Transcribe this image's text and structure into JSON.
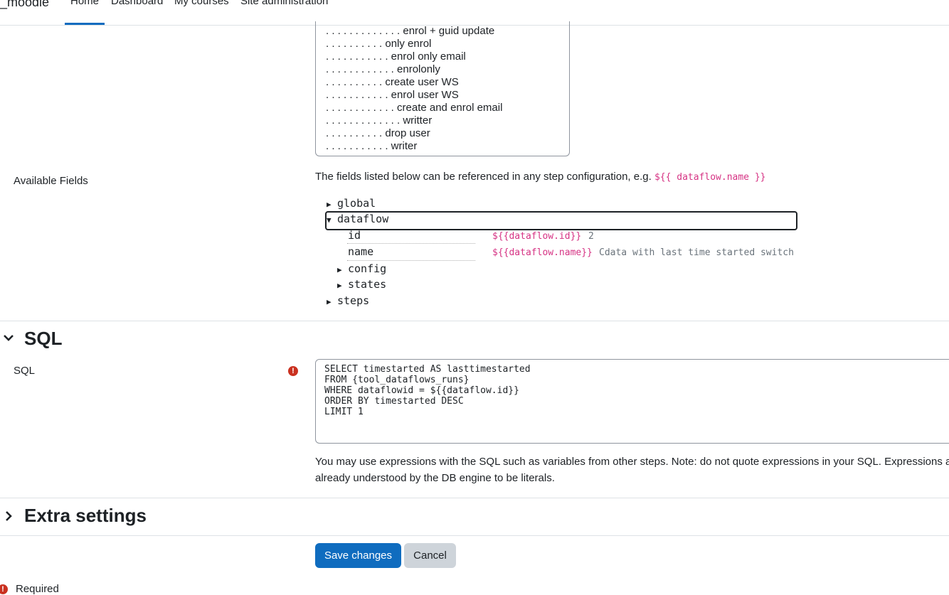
{
  "navbar": {
    "brand": "_moodle",
    "items": [
      {
        "label": "Home",
        "active": true
      },
      {
        "label": "Dashboard"
      },
      {
        "label": "My courses"
      },
      {
        "label": "Site administration"
      }
    ]
  },
  "steps_list": {
    "items": [
      ". . . . . . . . . . . . . enrol + guid update",
      ". . . . . . . . . . only enrol",
      ". . . . . . . . . . . enrol only email",
      ". . . . . . . . . . . . enrolonly",
      ". . . . . . . . . . create user WS",
      ". . . . . . . . . . . enrol user WS",
      ". . . . . . . . . . . . create and enrol email",
      ". . . . . . . . . . . . . writter",
      ". . . . . . . . . . drop user",
      ". . . . . . . . . . . writer"
    ]
  },
  "available_fields": {
    "label": "Available Fields",
    "help_prefix": "The fields listed below can be referenced in any step configuration, e.g. ",
    "help_example": "${{ dataflow.name }}",
    "tree": {
      "global": "global",
      "dataflow": "dataflow",
      "leaves": [
        {
          "name": "id",
          "expression": "${{dataflow.id}}",
          "value": "2"
        },
        {
          "name": "name",
          "expression": "${{dataflow.name}}",
          "value": "Cdata with last time started switch"
        }
      ],
      "config": "config",
      "states": "states",
      "steps": "steps"
    }
  },
  "sql_section": {
    "title": "SQL",
    "field_label": "SQL",
    "required_icon": "exclamation-circle-icon",
    "sql_lines": [
      "SELECT timestarted AS lasttimestarted",
      "FROM {tool_dataflows_runs}",
      "WHERE dataflowid = ${{dataflow.id}}",
      "ORDER BY timestarted DESC",
      "LIMIT 1"
    ],
    "help_line1": "You may use expressions with the SQL such as variables from other steps. Note: do not quote expressions in your SQL. Expressions a",
    "help_line2": "already understood by the DB engine to be literals."
  },
  "extra_section": {
    "title": "Extra settings"
  },
  "buttons": {
    "save": "Save changes",
    "cancel": "Cancel"
  },
  "required_note": "Required",
  "colors": {
    "primary": "#0f6cbf",
    "danger": "#ca3120",
    "code": "#d63384"
  }
}
